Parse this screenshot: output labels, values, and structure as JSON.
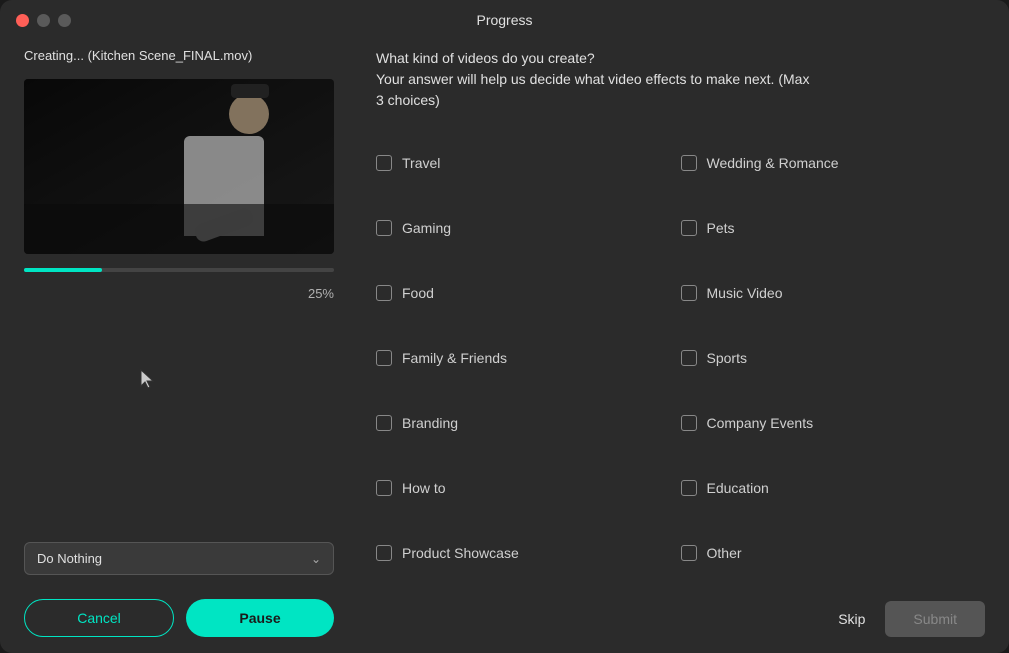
{
  "window": {
    "title": "Progress",
    "traffic_lights": {
      "close": "close",
      "minimize": "minimize",
      "maximize": "maximize"
    }
  },
  "left_panel": {
    "creating_label": "Creating... (Kitchen Scene_FINAL.mov)",
    "progress_percent": "25%",
    "dropdown_label": "Do Nothing",
    "cancel_button": "Cancel",
    "pause_button": "Pause"
  },
  "right_panel": {
    "question_line1": "What kind of videos do you create?",
    "question_line2": "Your answer will help us decide what video effects to make next.  (Max",
    "question_line3": "3 choices)",
    "checkboxes": [
      {
        "id": "travel",
        "label": "Travel",
        "checked": false,
        "col": 1
      },
      {
        "id": "wedding",
        "label": "Wedding & Romance",
        "checked": false,
        "col": 2
      },
      {
        "id": "gaming",
        "label": "Gaming",
        "checked": false,
        "col": 1
      },
      {
        "id": "pets",
        "label": "Pets",
        "checked": false,
        "col": 2
      },
      {
        "id": "food",
        "label": "Food",
        "checked": false,
        "col": 1
      },
      {
        "id": "music-video",
        "label": "Music Video",
        "checked": false,
        "col": 2
      },
      {
        "id": "family-friends",
        "label": "Family & Friends",
        "checked": false,
        "col": 1
      },
      {
        "id": "sports",
        "label": "Sports",
        "checked": false,
        "col": 2
      },
      {
        "id": "branding",
        "label": "Branding",
        "checked": false,
        "col": 1
      },
      {
        "id": "company-events",
        "label": "Company Events",
        "checked": false,
        "col": 2
      },
      {
        "id": "how-to",
        "label": "How to",
        "checked": false,
        "col": 1
      },
      {
        "id": "education",
        "label": "Education",
        "checked": false,
        "col": 2
      },
      {
        "id": "product-showcase",
        "label": "Product Showcase",
        "checked": false,
        "col": 1
      },
      {
        "id": "other",
        "label": "Other",
        "checked": false,
        "col": 2
      }
    ],
    "skip_button": "Skip",
    "submit_button": "Submit"
  }
}
